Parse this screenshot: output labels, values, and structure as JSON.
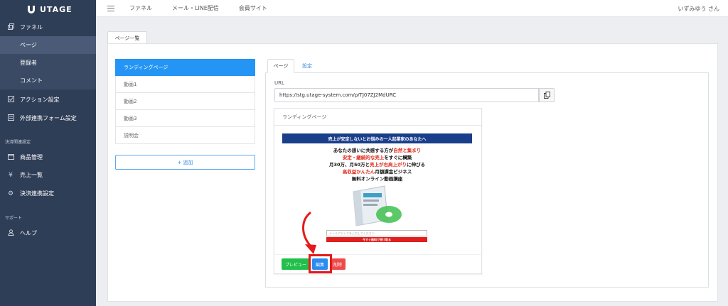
{
  "sidebar": {
    "logo_text": "UTAGE",
    "items": [
      {
        "label": "ファネル",
        "icon": "funnel-icon"
      },
      {
        "label": "ページ"
      },
      {
        "label": "登録者"
      },
      {
        "label": "コメント"
      },
      {
        "label": "アクション設定",
        "icon": "action-icon"
      },
      {
        "label": "外部連携フォーム設定",
        "icon": "form-icon"
      }
    ],
    "section_payment": "決済関連設定",
    "payment_items": [
      {
        "label": "商品管理",
        "icon": "calendar-icon"
      },
      {
        "label": "売上一覧",
        "icon": "yen-icon"
      },
      {
        "label": "決済連携設定",
        "icon": "gear-icon"
      }
    ],
    "section_support": "サポート",
    "support_items": [
      {
        "label": "ヘルプ",
        "icon": "user-icon"
      }
    ]
  },
  "topbar": {
    "links": [
      "ファネル",
      "メール・LINE配信",
      "会員サイト"
    ],
    "user": "いずみゆう さん"
  },
  "page_tab": "ページ一覧",
  "page_list": {
    "items": [
      "ランディングページ",
      "動画1",
      "動画2",
      "動画3",
      "説明会"
    ],
    "add_label": "+ 追加"
  },
  "detail": {
    "tabs": [
      "ページ",
      "設定"
    ],
    "url_label": "URL",
    "url_value": "https://stg.utage-system.com/p/TJ07ZJ2MdURC",
    "card_title": "ランディングページ",
    "buttons": {
      "preview": "プレビュー",
      "edit": "編集",
      "delete": "削除"
    }
  },
  "lp_preview": {
    "banner": "売上が安定しないとお悩みの一人起業家のあなたへ",
    "line1_a": "あなたの想いに共感する方が",
    "line1_b": "自然と集まり",
    "line2_a": "安定・継続的な売上",
    "line2_b": "をすぐに構築",
    "line3_a": "月30万、月50万と",
    "line3_b": "売上が右肩上がり",
    "line3_c": "に伸びる",
    "line4_a": "高収益かんたん",
    "line4_b": "月額課金ビジネス",
    "line5": "無料オンライン動画講座",
    "email_placeholder": "メールアドレスを入力してください",
    "cta": "今すぐ無料で受け取る"
  },
  "colors": {
    "sidebar": "#2f3e57",
    "accent": "#2495f4",
    "highlight": "#e51a1a"
  }
}
